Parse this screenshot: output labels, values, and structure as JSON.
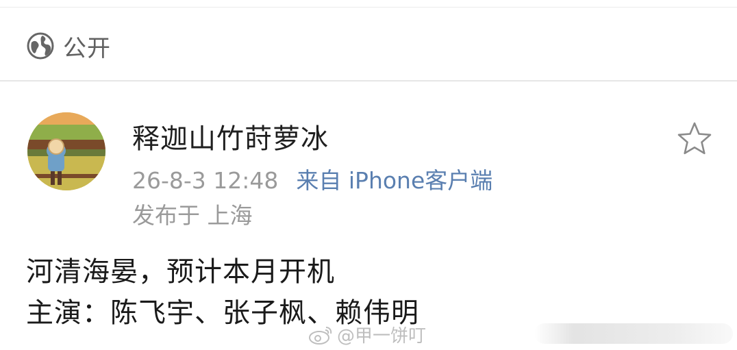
{
  "visibility": {
    "icon": "globe-icon",
    "label": "公开"
  },
  "post": {
    "author": "释迦山竹莳萝冰",
    "time": "26-8-3 12:48",
    "source": "来自 iPhone客户端",
    "location": "发布于 上海",
    "content_lines": [
      "河清海晏，预计本月开机",
      "主演：陈飞宇、张子枫、赖伟明"
    ],
    "favorite_icon": "star-icon"
  },
  "watermark": {
    "text": "@甲一饼叮",
    "icon": "weibo-icon"
  },
  "colors": {
    "name": "#1f1f1f",
    "meta": "#9a9a9a",
    "client_link": "#5a7fb0",
    "divider": "#e6e6e6"
  }
}
